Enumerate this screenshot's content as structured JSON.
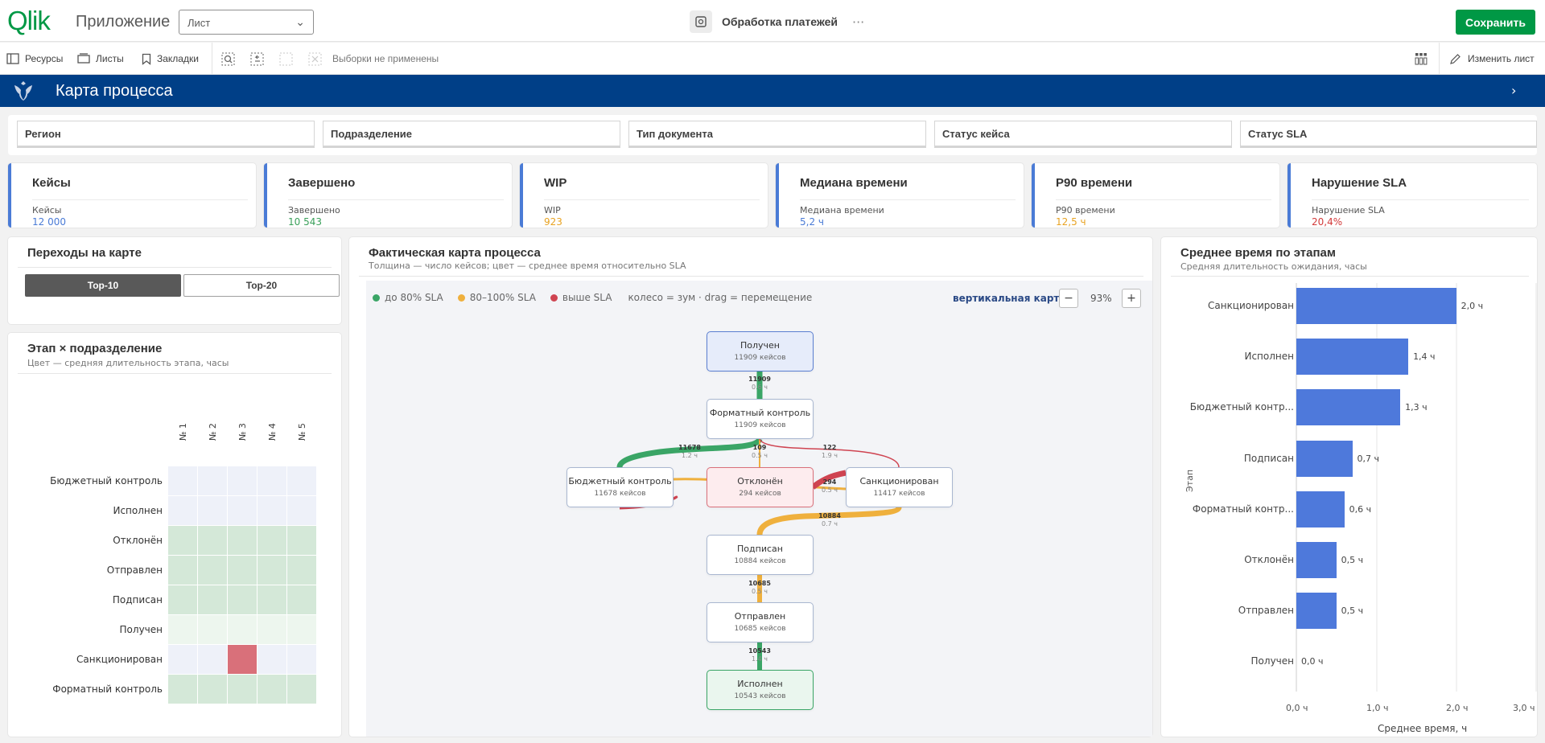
{
  "header": {
    "logo": "Qlik",
    "app_name": "Приложение",
    "sheet_select": "Лист",
    "app_title": "Обработка платежей",
    "more": "···",
    "save": "Сохранить"
  },
  "toolbar": {
    "resources": "Ресурсы",
    "sheets": "Листы",
    "bookmarks": "Закладки",
    "no_selections": "Выборки не применены",
    "edit_sheet": "Изменить лист"
  },
  "banner": {
    "title": "Карта процесса"
  },
  "filters": [
    "Регион",
    "Подразделение",
    "Тип документа",
    "Статус кейса",
    "Статус SLA"
  ],
  "kpis": [
    {
      "title": "Кейсы",
      "label": "Кейсы",
      "value": "12 000",
      "color": "#4a7bd6"
    },
    {
      "title": "Завершено",
      "label": "Завершено",
      "value": "10 543",
      "color": "#3aa05a"
    },
    {
      "title": "WIP",
      "label": "WIP",
      "value": "923",
      "color": "#e8a322"
    },
    {
      "title": "Медиана времени",
      "label": "Медиана времени",
      "value": "5,2 ч",
      "color": "#4a7bd6"
    },
    {
      "title": "P90 времени",
      "label": "P90 времени",
      "value": "12,5 ч",
      "color": "#e8a322"
    },
    {
      "title": "Нарушение SLA",
      "label": "Нарушение SLA",
      "value": "20,4%",
      "color": "#d23a3a"
    }
  ],
  "transitions": {
    "title": "Переходы на карте",
    "top10": "Top-10",
    "top20": "Top-20"
  },
  "heatmap": {
    "title": "Этап × подразделение",
    "subtitle": "Цвет — средняя длительность этапа, часы",
    "columns": [
      "№ 1",
      "№ 2",
      "№ 3",
      "№ 4",
      "№ 5"
    ],
    "rows": [
      {
        "name": "Бюджетный контроль",
        "colors": [
          "#eef1f9",
          "#eef1f9",
          "#eef1f9",
          "#eef1f9",
          "#eef1f9"
        ]
      },
      {
        "name": "Исполнен",
        "colors": [
          "#eef1f9",
          "#eef1f9",
          "#eef1f9",
          "#eef1f9",
          "#eef1f9"
        ]
      },
      {
        "name": "Отклонён",
        "colors": [
          "#d4e8d8",
          "#d4e8d8",
          "#d4e8d8",
          "#d4e8d8",
          "#d4e8d8"
        ]
      },
      {
        "name": "Отправлен",
        "colors": [
          "#d4e8d8",
          "#d4e8d8",
          "#d4e8d8",
          "#d4e8d8",
          "#d4e8d8"
        ]
      },
      {
        "name": "Подписан",
        "colors": [
          "#d4e8d8",
          "#d4e8d8",
          "#d4e8d8",
          "#d4e8d8",
          "#d4e8d8"
        ]
      },
      {
        "name": "Получен",
        "colors": [
          "#edf6ee",
          "#edf6ee",
          "#edf6ee",
          "#edf6ee",
          "#edf6ee"
        ]
      },
      {
        "name": "Санкционирован",
        "colors": [
          "#eef1f9",
          "#eef1f9",
          "#d9707a",
          "#eef1f9",
          "#eef1f9"
        ]
      },
      {
        "name": "Форматный контроль",
        "colors": [
          "#d4e8d8",
          "#d4e8d8",
          "#d4e8d8",
          "#d4e8d8",
          "#d4e8d8"
        ]
      }
    ]
  },
  "process_map": {
    "title": "Фактическая карта процесса",
    "subtitle": "Толщина — число кейсов; цвет — среднее время относительно SLA",
    "legend": [
      "до 80% SLA",
      "80–100% SLA",
      "выше SLA"
    ],
    "hint": "колесо = зум · drag = перемещение",
    "vertical": "вертикальная карта",
    "zoom": "93%",
    "nodes": [
      {
        "name": "Получен",
        "count": "11909 кейсов"
      },
      {
        "name": "Форматный контроль",
        "count": "11909 кейсов"
      },
      {
        "name": "Бюджетный контроль",
        "count": "11678 кейсов"
      },
      {
        "name": "Отклонён",
        "count": "294 кейсов"
      },
      {
        "name": "Санкционирован",
        "count": "11417 кейсов"
      },
      {
        "name": "Подписан",
        "count": "10884 кейсов"
      },
      {
        "name": "Отправлен",
        "count": "10685 кейсов"
      },
      {
        "name": "Исполнен",
        "count": "10543 кейсов"
      }
    ],
    "edges": [
      {
        "n": "11909",
        "t": "0.6 ч"
      },
      {
        "n": "11678",
        "t": "1.2 ч"
      },
      {
        "n": "109",
        "t": "0.5 ч"
      },
      {
        "n": "122",
        "t": "1.9 ч"
      },
      {
        "n": "294",
        "t": "0.5 ч"
      },
      {
        "n": "10884",
        "t": "0.7 ч"
      },
      {
        "n": "10685",
        "t": "0.5 ч"
      },
      {
        "n": "10543",
        "t": "1.4 ч"
      }
    ]
  },
  "stage_time": {
    "title": "Среднее время по этапам",
    "subtitle": "Средняя длительность ожидания, часы",
    "ylabel": "Этап",
    "xlabel": "Среднее время, ч",
    "ticks": [
      "0,0 ч",
      "1,0 ч",
      "2,0 ч",
      "3,0 ч"
    ]
  },
  "chart_data": {
    "type": "bar",
    "orientation": "horizontal",
    "title": "Среднее время по этапам",
    "subtitle": "Средняя длительность ожидания, часы",
    "xlabel": "Среднее время, ч",
    "ylabel": "Этап",
    "categories": [
      "Санкционирован",
      "Исполнен",
      "Бюджетный контр...",
      "Подписан",
      "Форматный контр...",
      "Отклонён",
      "Отправлен",
      "Получен"
    ],
    "values": [
      2.0,
      1.4,
      1.3,
      0.7,
      0.6,
      0.5,
      0.5,
      0.0
    ],
    "value_labels": [
      "2,0 ч",
      "1,4 ч",
      "1,3 ч",
      "0,7 ч",
      "0,6 ч",
      "0,5 ч",
      "0,5 ч",
      "0,0 ч"
    ],
    "xlim": [
      0,
      3
    ],
    "color": "#4e79db"
  }
}
